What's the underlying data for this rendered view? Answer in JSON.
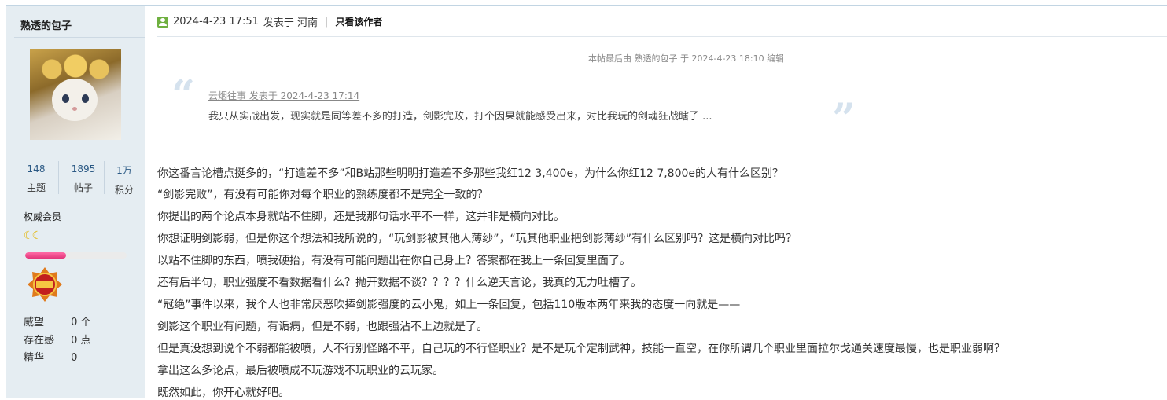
{
  "sidebar": {
    "author": "熟透的包子",
    "stats": [
      {
        "value": "148",
        "label": "主题"
      },
      {
        "value": "1895",
        "label": "帖子"
      },
      {
        "value": "1万",
        "label": "积分"
      }
    ],
    "group": "权威会员",
    "level_icon": "moon-icon",
    "progress_fraction": 0.4,
    "info": [
      {
        "key": "威望",
        "value": "0 个"
      },
      {
        "key": "存在感",
        "value": "0 点"
      },
      {
        "key": "精华",
        "value": "0"
      }
    ]
  },
  "post": {
    "timestamp": "2024-4-23 17:51",
    "posted_in": "发表于 河南",
    "separator": "|",
    "only_author": "只看该作者",
    "edited_note": "本帖最后由 熟透的包子 于 2024-4-23 18:10 编辑",
    "quote": {
      "meta": "云烟往事 发表于 2024-4-23 17:14",
      "text": "我只从实战出发，现实就是同等差不多的打造，剑影完败，打个因果就能感受出来，对比我玩的剑魂狂战瞎子 ..."
    },
    "lines": [
      "你这番言论槽点挺多的，“打造差不多”和B站那些明明打造差不多那些我红12 3,400e，为什么你红12 7,800e的人有什么区别？",
      "“剑影完败”，有没有可能你对每个职业的熟练度都不是完全一致的？",
      "你提出的两个论点本身就站不住脚，还是我那句话水平不一样，这并非是横向对比。",
      "你想证明剑影弱，但是你这个想法和我所说的，“玩剑影被其他人薄纱”，“玩其他职业把剑影薄纱”有什么区别吗？这是横向对比吗？",
      "以站不住脚的东西，喷我硬抬，有没有可能问题出在你自己身上？答案都在我上一条回复里面了。",
      "还有后半句，职业强度不看数据看什么？抛开数据不谈？？？？什么逆天言论，我真的无力吐槽了。",
      "“冠绝”事件以来，我个人也非常厌恶吹捧剑影强度的云小鬼，如上一条回复，包括110版本两年来我的态度一向就是——",
      "剑影这个职业有问题，有诟病，但是不弱，也跟强沾不上边就是了。",
      "但是真没想到说个不弱都能被喷，人不行别怪路不平，自己玩的不行怪职业？是不是玩个定制武神，技能一直空，在你所谓几个职业里面拉尔戈通关速度最慢，也是职业弱啊？",
      "拿出这么多论点，最后被喷成不玩游戏不玩职业的云玩家。",
      "既然如此，你开心就好吧。"
    ]
  },
  "colors": {
    "sidebar_bg": "#e5edf2",
    "link_blue": "#2c5a85",
    "progress_pink": "#e2357a",
    "online_green": "#6fb040"
  }
}
